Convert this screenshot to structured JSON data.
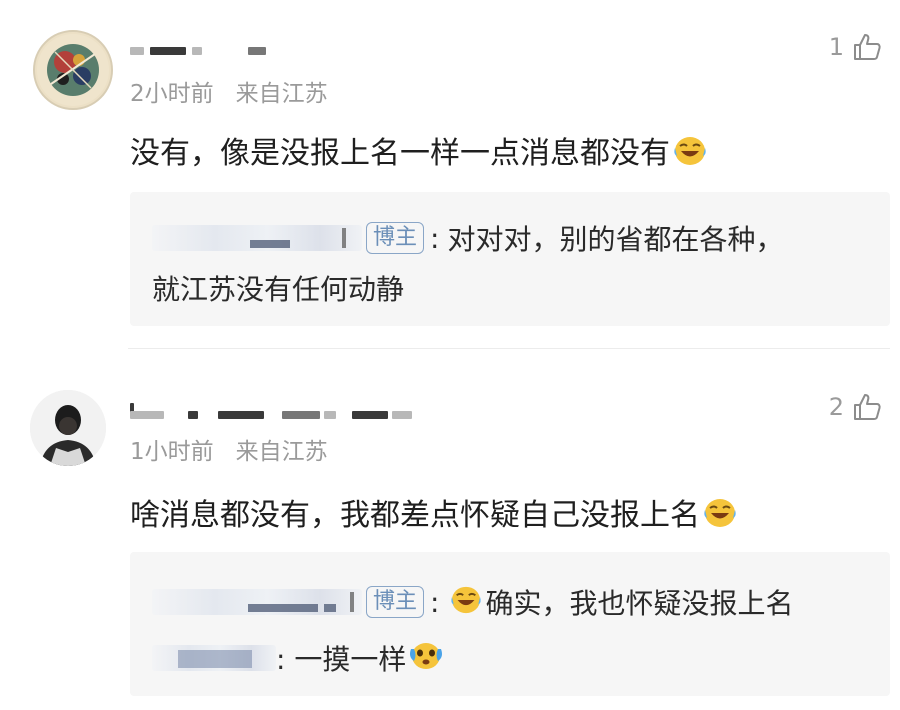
{
  "comments": [
    {
      "time": "2小时前",
      "location": "来自江苏",
      "likes": "1",
      "text": "没有，像是没报上名一样一点消息都没有",
      "emoji": "laugh-cry-emoji",
      "reply": {
        "badge": "博主",
        "sep": ":",
        "text": "对对对，别的省都在各种，",
        "text2": "就江苏没有任何动静"
      }
    },
    {
      "time": "1小时前",
      "location": "来自江苏",
      "likes": "2",
      "text": "啥消息都没有，我都差点怀疑自己没报上名",
      "emoji": "laugh-cry-emoji",
      "reply": {
        "badge": "博主",
        "sep": ":",
        "text": "确实，我也怀疑没报上名",
        "text2": ": 一摸一样"
      }
    }
  ],
  "colors": {
    "meta": "#9a9a9a",
    "badge": "#6b8fb8",
    "reply_bg": "#f6f6f6"
  }
}
